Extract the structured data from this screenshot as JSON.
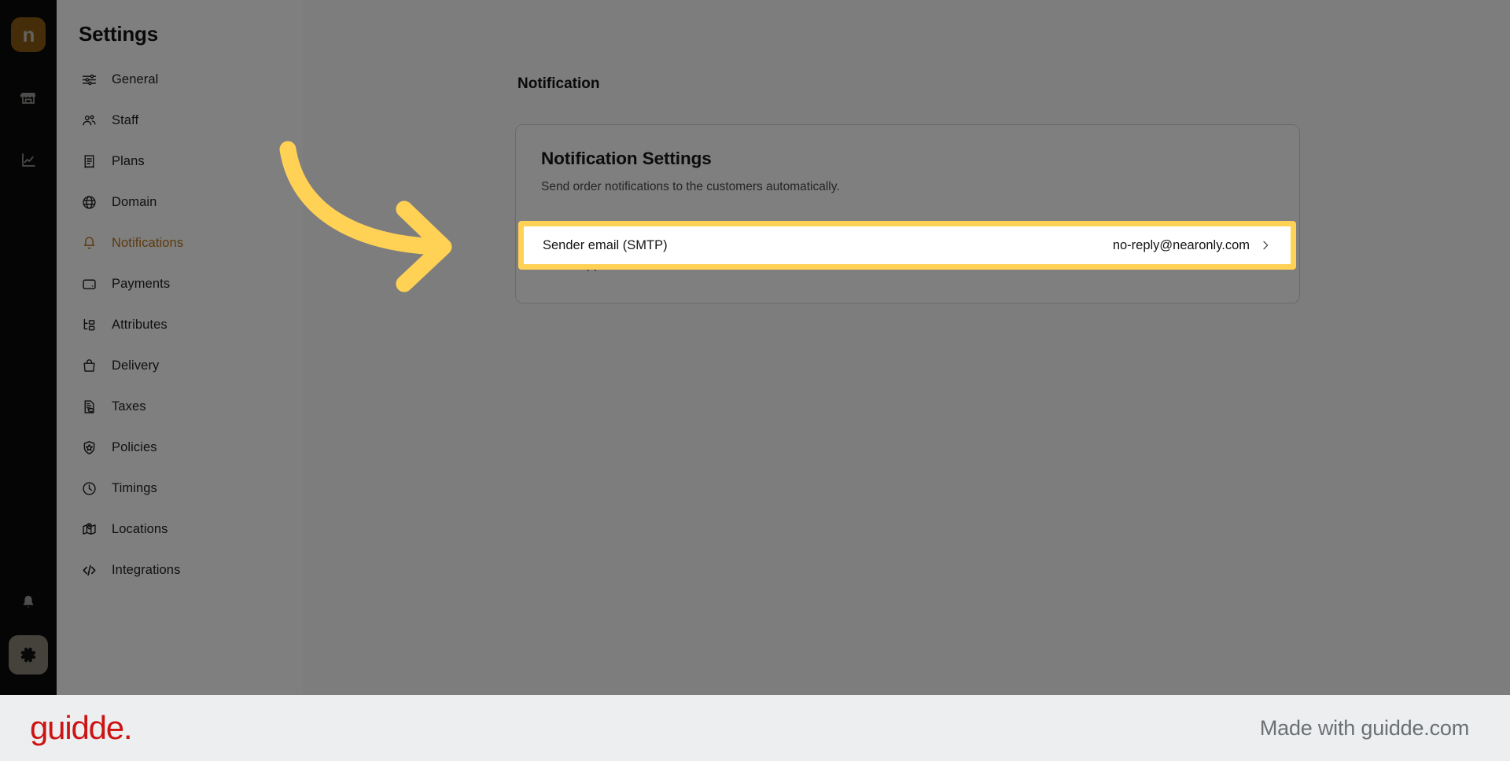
{
  "app": {
    "brand_glyph": "n",
    "rail_icons": [
      {
        "name": "store-icon"
      },
      {
        "name": "analytics-icon"
      }
    ],
    "rail_bottom_icons": [
      {
        "name": "bell-icon"
      },
      {
        "name": "gear-icon"
      }
    ]
  },
  "sidebar": {
    "title": "Settings",
    "active_index": 5,
    "items": [
      {
        "label": "General",
        "icon": "sliders-icon"
      },
      {
        "label": "Staff",
        "icon": "users-icon"
      },
      {
        "label": "Plans",
        "icon": "receipt-icon"
      },
      {
        "label": "Domain",
        "icon": "globe-icon"
      },
      {
        "label": "Notifications",
        "icon": "bell-icon"
      },
      {
        "label": "Payments",
        "icon": "wallet-icon"
      },
      {
        "label": "Attributes",
        "icon": "hierarchy-icon"
      },
      {
        "label": "Delivery",
        "icon": "bag-icon"
      },
      {
        "label": "Taxes",
        "icon": "tax-document-icon"
      },
      {
        "label": "Policies",
        "icon": "shield-star-icon"
      },
      {
        "label": "Timings",
        "icon": "clock-icon"
      },
      {
        "label": "Locations",
        "icon": "map-pin-icon"
      },
      {
        "label": "Integrations",
        "icon": "code-brackets-icon"
      }
    ]
  },
  "main": {
    "heading": "Notification",
    "card": {
      "title": "Notification Settings",
      "subtitle": "Send order notifications to the customers automatically.",
      "rows": [
        {
          "label": "Sender email (SMTP)",
          "value": "no-reply@nearonly.com",
          "highlighted": true
        },
        {
          "label": "WhatsApp notifications",
          "value": "none",
          "highlighted": false
        }
      ]
    }
  },
  "overlay": {
    "highlight_color": "#ffd155",
    "arrow_color": "#ffd155",
    "dim_color": "rgba(0,0,0,0.5)"
  },
  "footer": {
    "logo_text": "guidde.",
    "made_with_text": "Made with guidde.com",
    "logo_color": "#cc1414"
  }
}
